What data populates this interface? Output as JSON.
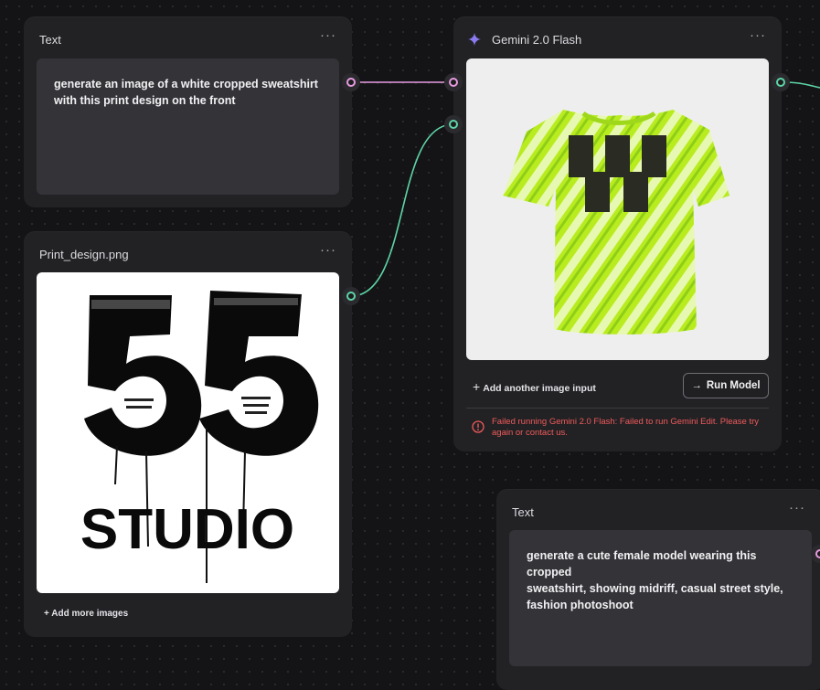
{
  "nodes": {
    "text_top": {
      "title": "Text",
      "menu": "···",
      "content": "generate an image of a white cropped sweatshirt with this print design on the front"
    },
    "print_design": {
      "title": "Print_design.png",
      "menu": "···",
      "image_big_numeral": "55",
      "image_word": "STUDIO",
      "add_more": "+ Add more images"
    },
    "gemini": {
      "title": "Gemini 2.0 Flash",
      "menu": "···",
      "add_input": "Add another image input",
      "run_label": "Run Model",
      "error": "Failed running Gemini 2.0 Flash: Failed to run Gemini Edit. Please try again or contact us."
    },
    "text_bottom": {
      "title": "Text",
      "menu": "···",
      "line1": "generate a cute female model wearing this cropped",
      "line2": "sweatshirt, showing midriff, casual street style, fashion photoshoot"
    }
  },
  "colors": {
    "text_edge": "#e79be0",
    "image_edge": "#5ed4a6",
    "error": "#ef5a5a",
    "gemini_spark": "#8a7bf0"
  }
}
